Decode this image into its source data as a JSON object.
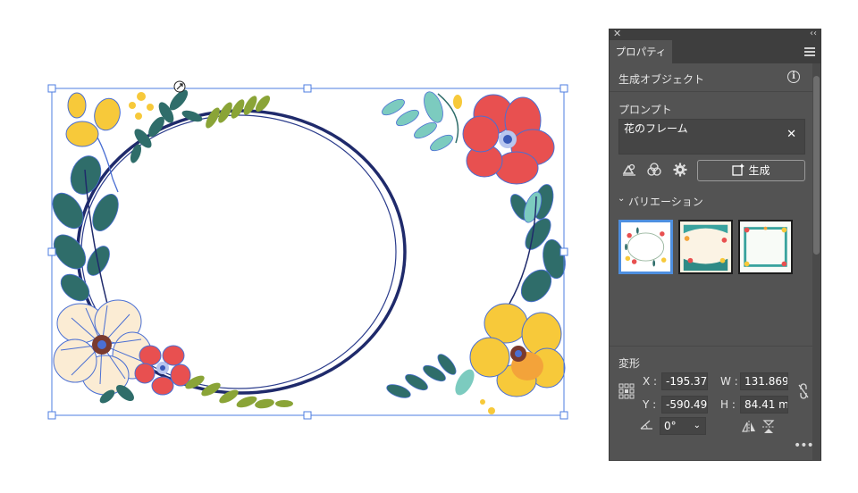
{
  "panel": {
    "tab_label": "プロパティ",
    "section_title": "生成オブジェクト",
    "prompt_section_label": "プロンプト",
    "prompt_value": "花のフレーム",
    "generate_label": "生成",
    "variations_label": "バリエーション",
    "transform_label": "変形",
    "transform": {
      "x_label": "X :",
      "x_value": "-195.37",
      "y_label": "Y :",
      "y_value": "-590.49",
      "w_label": "W :",
      "w_value": "131.869",
      "h_label": "H :",
      "h_value": "84.41 m",
      "angle_value": "0°"
    }
  },
  "icons": [
    "close-icon",
    "collapse-icon",
    "panel-menu-icon",
    "info-icon",
    "clear-icon",
    "style-reference-icon",
    "color-icon",
    "settings-icon",
    "generate-icon",
    "chevron-down-icon",
    "reference-point-icon",
    "link-proportions-icon",
    "angle-icon",
    "flip-horizontal-icon",
    "flip-vertical-icon",
    "more-options-icon"
  ],
  "colors": {
    "panel_bg": "#535353",
    "field_bg": "#454545",
    "selection_accent": "#4d8fe0"
  }
}
